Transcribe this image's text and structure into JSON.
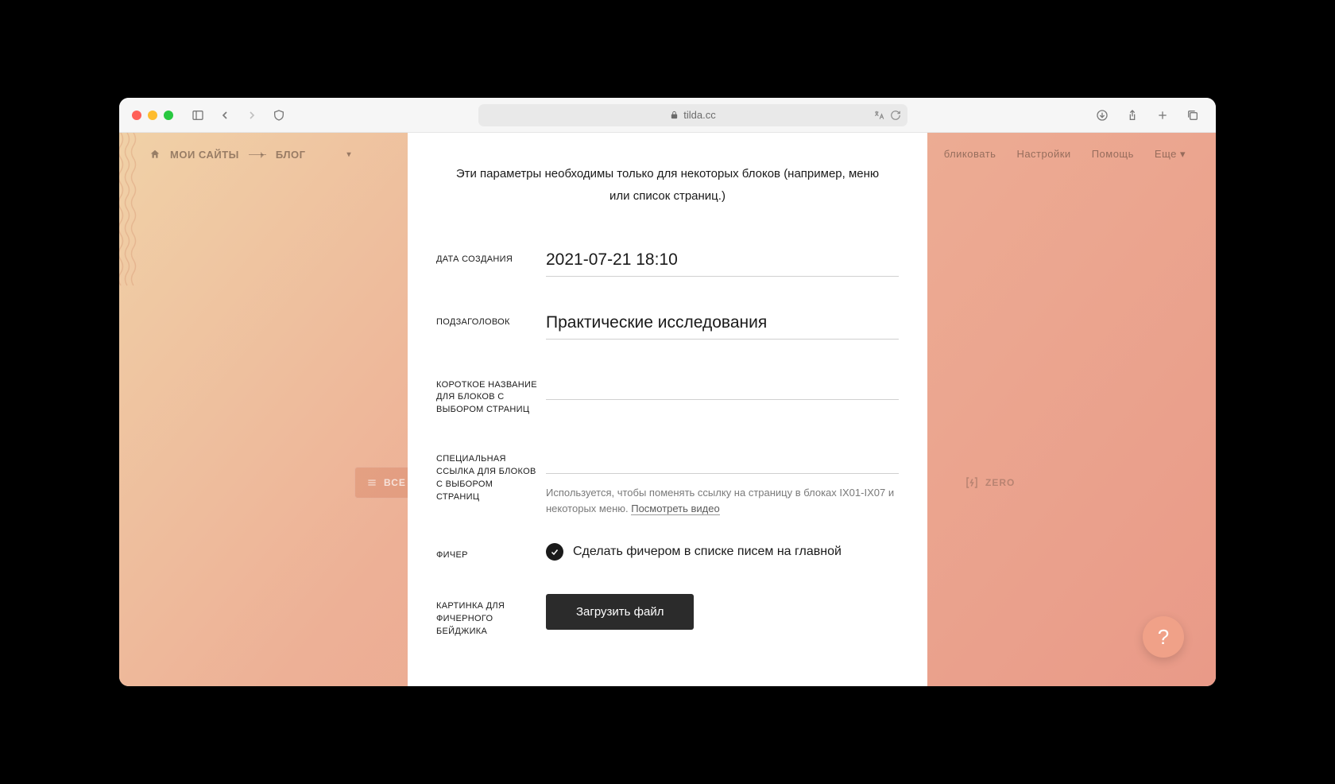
{
  "browser": {
    "url_host": "tilda.cc"
  },
  "nav": {
    "crumb_home": "МОИ САЙТЫ",
    "crumb_project": "БЛОГ",
    "publish": "бликовать",
    "settings": "Настройки",
    "help": "Помощь",
    "more": "Еще"
  },
  "bg": {
    "all_blocks": "ВСЕ БЛОК",
    "zero": "ZERO"
  },
  "modal": {
    "intro": "Эти параметры необходимы только для некоторых блоков (например, меню или список страниц.)",
    "fields": {
      "date_label": "ДАТА СОЗДАНИЯ",
      "date_value": "2021-07-21 18:10",
      "subtitle_label": "ПОДЗАГОЛОВОК",
      "subtitle_value": "Практические исследования",
      "shortname_label": "КОРОТКОЕ НАЗВАНИЕ ДЛЯ БЛОКОВ С ВЫБОРОМ СТРАНИЦ",
      "shortname_value": "",
      "speclink_label": "СПЕЦИАЛЬНАЯ ССЫЛКА ДЛЯ БЛОКОВ С ВЫБОРОМ СТРАНИЦ",
      "speclink_value": "",
      "speclink_hint_a": "Используется, чтобы поменять ссылку на страницу в блоках IX01-IX07 и некоторых меню. ",
      "speclink_hint_link": "Посмотреть видео",
      "feature_label": "ФИЧЕР",
      "feature_text": "Сделать фичером в списке писем на главной",
      "feature_checked": true,
      "badgeimg_label": "КАРТИНКА ДЛЯ ФИЧЕРНОГО БЕЙДЖИКА",
      "upload_btn": "Загрузить файл"
    }
  },
  "help_bubble": "?"
}
